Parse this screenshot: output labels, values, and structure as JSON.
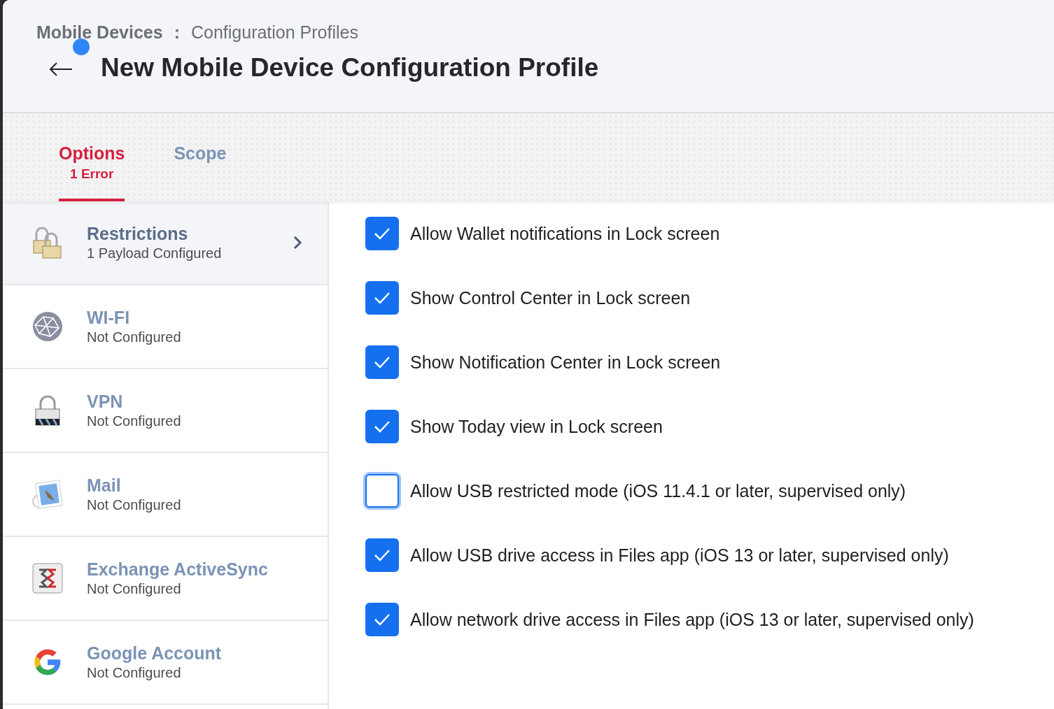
{
  "breadcrumb": {
    "section": "Mobile Devices",
    "separator": ":",
    "page": "Configuration Profiles"
  },
  "header": {
    "title": "New Mobile Device Configuration Profile",
    "unsaved_indicator": true
  },
  "tabs": [
    {
      "label": "Options",
      "note": "1 Error",
      "selected": true
    },
    {
      "label": "Scope",
      "selected": false
    }
  ],
  "payloads": [
    {
      "kind": "restrictions",
      "title": "Restrictions",
      "status": "1 Payload Configured",
      "selected": true
    },
    {
      "kind": "wifi",
      "title": "WI-FI",
      "status": "Not Configured",
      "selected": false
    },
    {
      "kind": "vpn",
      "title": "VPN",
      "status": "Not Configured",
      "selected": false
    },
    {
      "kind": "mail",
      "title": "Mail",
      "status": "Not Configured",
      "selected": false
    },
    {
      "kind": "exchange",
      "title": "Exchange ActiveSync",
      "status": "Not Configured",
      "selected": false
    },
    {
      "kind": "google",
      "title": "Google Account",
      "status": "Not Configured",
      "selected": false
    }
  ],
  "options": [
    {
      "label": "Allow Wallet notifications in Lock screen",
      "checked": true,
      "focused": false
    },
    {
      "label": "Show Control Center in Lock screen",
      "checked": true,
      "focused": false
    },
    {
      "label": "Show Notification Center in Lock screen",
      "checked": true,
      "focused": false
    },
    {
      "label": "Show Today view in Lock screen",
      "checked": true,
      "focused": false
    },
    {
      "label": "Allow USB restricted mode (iOS 11.4.1 or later, supervised only)",
      "checked": false,
      "focused": true
    },
    {
      "label": "Allow USB drive access in Files app (iOS 13 or later, supervised only)",
      "checked": true,
      "focused": false
    },
    {
      "label": "Allow network drive access in Files app (iOS 13 or later, supervised only)",
      "checked": true,
      "focused": false
    }
  ]
}
